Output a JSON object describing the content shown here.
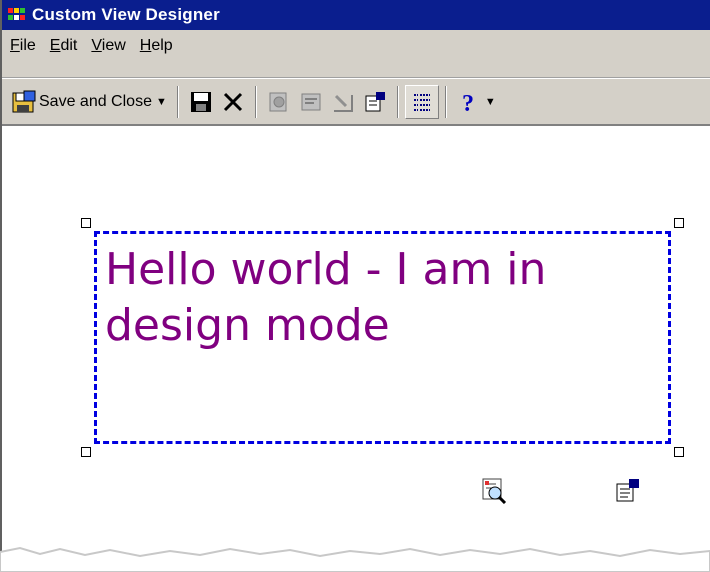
{
  "window": {
    "title": "Custom View Designer"
  },
  "menu": {
    "items": [
      {
        "label": "File",
        "mnemonic": "F",
        "rest": "ile"
      },
      {
        "label": "Edit",
        "mnemonic": "E",
        "rest": "dit"
      },
      {
        "label": "View",
        "mnemonic": "V",
        "rest": "iew"
      },
      {
        "label": "Help",
        "mnemonic": "H",
        "rest": "elp"
      }
    ]
  },
  "toolbar": {
    "save_and_close_label": "Save and Close",
    "buttons": [
      {
        "name": "save",
        "icon": "floppy-disk-icon"
      },
      {
        "name": "delete",
        "icon": "x-delete-icon"
      },
      {
        "name": "preview",
        "icon": "preview-icon"
      },
      {
        "name": "view-selector",
        "icon": "view-selector-icon"
      },
      {
        "name": "field-chooser",
        "icon": "field-chooser-icon"
      },
      {
        "name": "properties",
        "icon": "properties-icon"
      },
      {
        "name": "tab-order",
        "icon": "tab-order-icon"
      },
      {
        "name": "help",
        "icon": "help-icon"
      }
    ]
  },
  "canvas": {
    "label_text": "Hello world - I am in design mode",
    "label_color": "#800080",
    "selection_color": "#0000e0"
  },
  "colors": {
    "titlebar": "#0a1e8e",
    "chrome": "#d4d0c8"
  }
}
